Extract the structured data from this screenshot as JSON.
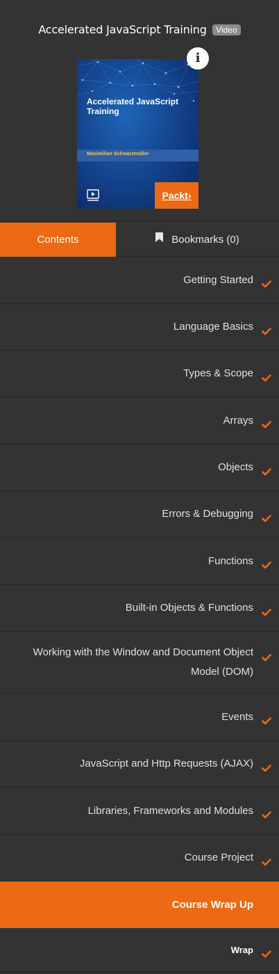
{
  "header": {
    "title": "Accelerated JavaScript Training",
    "badge": "Video",
    "info_icon": "info-icon",
    "info_glyph": "i"
  },
  "cover": {
    "title": "Accelerated JavaScript Training",
    "author": "Maximilian Schwarzmüller",
    "publisher": "Packt›",
    "play_icon": "video-play-icon"
  },
  "tabs": {
    "contents": "Contents",
    "bookmarks": "Bookmarks (0)",
    "bookmark_icon": "bookmark-icon"
  },
  "sections": [
    {
      "label": "Getting Started",
      "completed": true
    },
    {
      "label": "Language Basics",
      "completed": true
    },
    {
      "label": "Types & Scope",
      "completed": true
    },
    {
      "label": "Arrays",
      "completed": true
    },
    {
      "label": "Objects",
      "completed": true
    },
    {
      "label": "Errors & Debugging",
      "completed": true
    },
    {
      "label": "Functions",
      "completed": true
    },
    {
      "label": "Built-in Objects & Functions",
      "completed": true
    },
    {
      "label": "Working with the Window and Document Object Model (DOM)",
      "completed": true
    },
    {
      "label": "Events",
      "completed": true
    },
    {
      "label": "JavaScript and Http Requests (AJAX)",
      "completed": true
    },
    {
      "label": "Libraries, Frameworks and Modules",
      "completed": true
    },
    {
      "label": "Course Project",
      "completed": true
    },
    {
      "label": "Course Wrap Up",
      "completed": false,
      "active": true
    },
    {
      "label": "Wrap",
      "completed": true,
      "sub": true
    }
  ],
  "colors": {
    "accent": "#ec6a14",
    "background": "#333333",
    "divider": "#262626",
    "check": "#ec6a14"
  }
}
